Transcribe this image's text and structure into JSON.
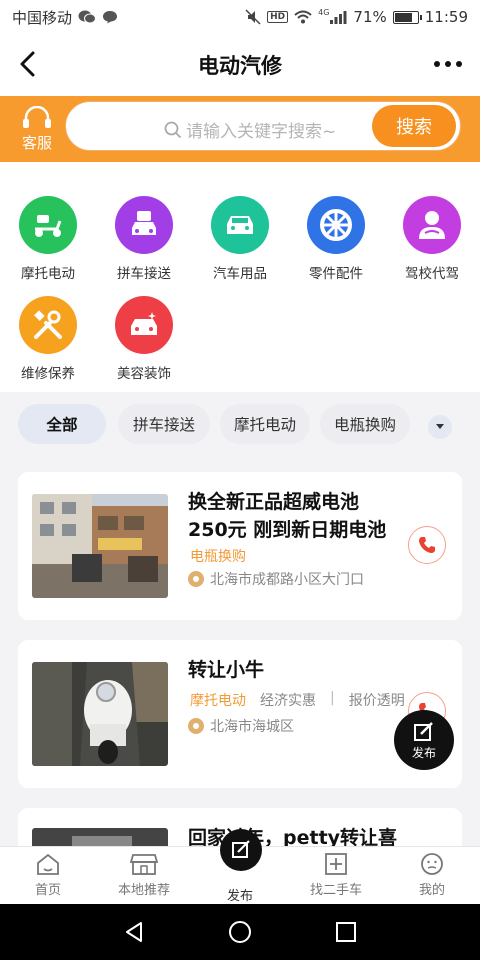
{
  "status_bar": {
    "carrier": "中国移动",
    "signal_label": "4G",
    "battery": "71%",
    "battery_level": 0.71,
    "time": "11:59",
    "hd": "HD"
  },
  "nav": {
    "title": "电动汽修"
  },
  "search": {
    "service_label": "客服",
    "placeholder": "请输入关键字搜索~",
    "button_label": "搜索"
  },
  "categories": [
    {
      "label": "摩托电动",
      "color": "#27c25c",
      "icon": "scooter-icon"
    },
    {
      "label": "拼车接送",
      "color": "#a23ee6",
      "icon": "carpool-icon"
    },
    {
      "label": "汽车用品",
      "color": "#1fc39a",
      "icon": "car-icon"
    },
    {
      "label": "零件配件",
      "color": "#2f73e6",
      "icon": "wheel-icon"
    },
    {
      "label": "驾校代驾",
      "color": "#c23ee0",
      "icon": "driver-icon"
    },
    {
      "label": "维修保养",
      "color": "#f7a21e",
      "icon": "tools-icon"
    },
    {
      "label": "美容装饰",
      "color": "#ef3f46",
      "icon": "car-wash-icon"
    }
  ],
  "filters": {
    "chips": [
      "全部",
      "拼车接送",
      "摩托电动",
      "电瓶换购"
    ]
  },
  "listings": [
    {
      "title": "换全新正品超威电池250元 刚到新日期电池",
      "tag": "电瓶换购",
      "location": "北海市成都路小区大门口"
    },
    {
      "title": "转让小牛",
      "tag": "摩托电动",
      "extra_tags": [
        "经济实惠",
        "报价透明"
      ],
      "location": "北海市海城区"
    },
    {
      "title": "回家过年，petty转让喜"
    }
  ],
  "fab": {
    "label": "发布"
  },
  "tabs": [
    {
      "label": "首页",
      "icon": "home-icon"
    },
    {
      "label": "本地推荐",
      "icon": "store-icon"
    },
    {
      "label": "发布",
      "icon": "publish-icon"
    },
    {
      "label": "找二手车",
      "icon": "plus-box-icon"
    },
    {
      "label": "我的",
      "icon": "profile-icon"
    }
  ]
}
